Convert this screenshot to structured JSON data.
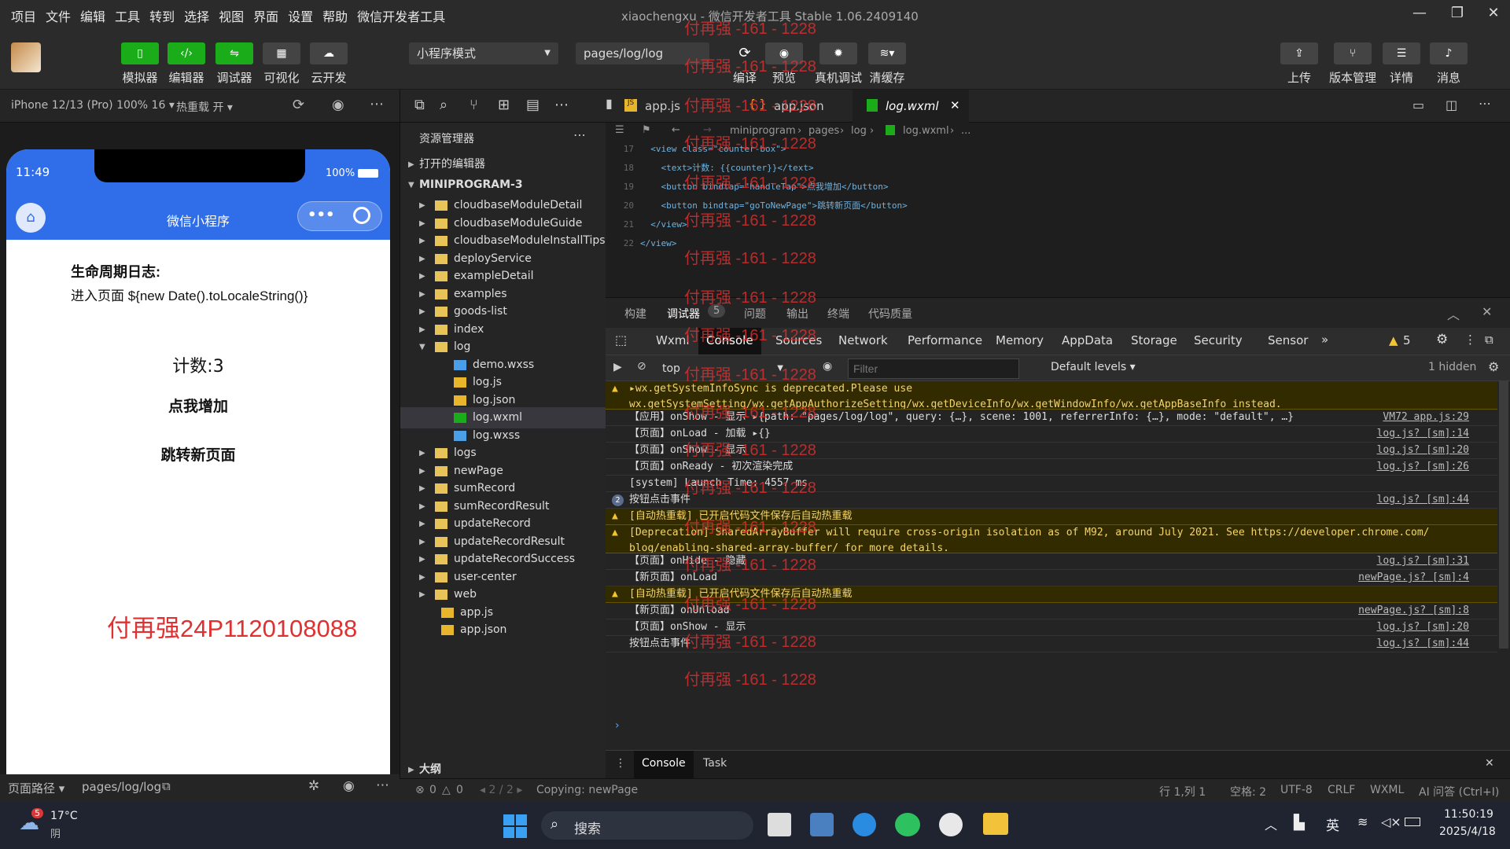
{
  "menu": [
    "项目",
    "文件",
    "编辑",
    "工具",
    "转到",
    "选择",
    "视图",
    "界面",
    "设置",
    "帮助",
    "微信开发者工具"
  ],
  "window_title": "xiaochengxu - 微信开发者工具 Stable 1.06.2409140",
  "toolbar": {
    "simulator": "模拟器",
    "editor": "编辑器",
    "debugger": "调试器",
    "visual": "可视化",
    "cloud": "云开发",
    "mode": "小程序模式",
    "path": "pages/log/log",
    "compile": "编译",
    "preview": "预览",
    "device_debug": "真机调试",
    "clear_cache": "清缓存",
    "upload": "上传",
    "version": "版本管理",
    "details": "详情",
    "messages": "消息"
  },
  "device": {
    "model": "iPhone 12/13 (Pro) 100% 16",
    "hot_reload": "热重载 开"
  },
  "phone": {
    "time": "11:49",
    "battery": "100%",
    "title": "微信小程序",
    "heading": "生命周期日志:",
    "log_line": "进入页面 ${new Date().toLocaleString()}",
    "counter": "计数:3",
    "btn_add": "点我增加",
    "btn_nav": "跳转新页面",
    "watermark": "付再强24P1120108088"
  },
  "sim_footer": {
    "path_label": "页面路径",
    "path": "pages/log/log"
  },
  "explorer": {
    "title": "资源管理器",
    "open_editors": "打开的编辑器",
    "project": "MINIPROGRAM-3",
    "outline": "大纲",
    "items": [
      {
        "n": "cloudbaseModuleDetail",
        "t": "dir",
        "d": 1
      },
      {
        "n": "cloudbaseModuleGuide",
        "t": "dir",
        "d": 1
      },
      {
        "n": "cloudbaseModuleInstallTips",
        "t": "dir",
        "d": 1
      },
      {
        "n": "deployService",
        "t": "dir",
        "d": 1
      },
      {
        "n": "exampleDetail",
        "t": "dir",
        "d": 1
      },
      {
        "n": "examples",
        "t": "dir",
        "d": 1
      },
      {
        "n": "goods-list",
        "t": "dir",
        "d": 1
      },
      {
        "n": "index",
        "t": "dir",
        "d": 1
      },
      {
        "n": "log",
        "t": "open",
        "d": 1
      },
      {
        "n": "demo.wxss",
        "t": "wxss",
        "d": 2
      },
      {
        "n": "log.js",
        "t": "js",
        "d": 2
      },
      {
        "n": "log.json",
        "t": "json",
        "d": 2
      },
      {
        "n": "log.wxml",
        "t": "wxml",
        "d": 2
      },
      {
        "n": "log.wxss",
        "t": "wxss",
        "d": 2
      },
      {
        "n": "logs",
        "t": "dir",
        "d": 1
      },
      {
        "n": "newPage",
        "t": "dir",
        "d": 1
      },
      {
        "n": "sumRecord",
        "t": "dir",
        "d": 1
      },
      {
        "n": "sumRecordResult",
        "t": "dir",
        "d": 1
      },
      {
        "n": "updateRecord",
        "t": "dir",
        "d": 1
      },
      {
        "n": "updateRecordResult",
        "t": "dir",
        "d": 1
      },
      {
        "n": "updateRecordSuccess",
        "t": "dir",
        "d": 1
      },
      {
        "n": "user-center",
        "t": "dir",
        "d": 1
      },
      {
        "n": "web",
        "t": "dir",
        "d": 1
      },
      {
        "n": "app.js",
        "t": "js",
        "d": 0
      },
      {
        "n": "app.json",
        "t": "json",
        "d": 0
      }
    ]
  },
  "tabs": [
    "app.js",
    "app.json",
    "log.wxml"
  ],
  "breadcrumb": [
    "miniprogram",
    "pages",
    "log",
    "log.wxml",
    "..."
  ],
  "code": [
    {
      "n": "17",
      "t": "  <view class=\"counter-box\">"
    },
    {
      "n": "18",
      "t": "    <text>计数: {{counter}}</text>"
    },
    {
      "n": "19",
      "t": "    <button bindtap=\"handleTap\">点我增加</button>"
    },
    {
      "n": "20",
      "t": "    <button bindtap=\"goToNewPage\">跳转新页面</button>"
    },
    {
      "n": "21",
      "t": "  </view>"
    },
    {
      "n": "22",
      "t": "</view>"
    }
  ],
  "panel_tabs": [
    "构建",
    "调试器",
    "5",
    "问题",
    "输出",
    "终端",
    "代码质量"
  ],
  "devtools_tabs": [
    "Wxml",
    "Console",
    "Sources",
    "Network",
    "Performance",
    "Memory",
    "AppData",
    "Storage",
    "Security",
    "Sensor"
  ],
  "warn_count": "5",
  "console": {
    "context": "top",
    "filter_placeholder": "Filter",
    "levels": "Default levels",
    "hidden": "1 hidden",
    "rows": [
      {
        "w": 1,
        "h": 36,
        "t": "▸wx.getSystemInfoSync is deprecated.Please use\nwx.getSystemSetting/wx.getAppAuthorizeSetting/wx.getDeviceInfo/wx.getWindowInfo/wx.getAppBaseInfo instead.",
        "s": ""
      },
      {
        "w": 0,
        "h": 21,
        "t": "【应用】onShow - 显示 ▸{path: \"pages/log/log\", query: {…}, scene: 1001, referrerInfo: {…}, mode: \"default\", …}",
        "s": "VM72 app.js:29"
      },
      {
        "w": 0,
        "h": 21,
        "t": "【页面】onLoad - 加载 ▸{}",
        "s": "log.js? [sm]:14"
      },
      {
        "w": 0,
        "h": 21,
        "t": "【页面】onShow - 显示",
        "s": "log.js? [sm]:20"
      },
      {
        "w": 0,
        "h": 21,
        "t": "【页面】onReady - 初次渲染完成",
        "s": "log.js? [sm]:26"
      },
      {
        "w": 0,
        "h": 21,
        "t": "[system] Launch Time: 4557 ms",
        "s": ""
      },
      {
        "w": 0,
        "h": 21,
        "t": "按钮点击事件",
        "s": "log.js? [sm]:44",
        "badge": "2"
      },
      {
        "w": 1,
        "h": 21,
        "t": "[自动热重载] 已开启代码文件保存后自动热重载",
        "s": ""
      },
      {
        "w": 1,
        "h": 36,
        "t": "[Deprecation] SharedArrayBuffer will require cross-origin isolation as of M92, around July 2021. See https://developer.chrome.com/\nblog/enabling-shared-array-buffer/ for more details.",
        "s": ""
      },
      {
        "w": 0,
        "h": 21,
        "t": "【页面】onHide - 隐藏",
        "s": "log.js? [sm]:31"
      },
      {
        "w": 0,
        "h": 21,
        "t": "【新页面】onLoad",
        "s": "newPage.js? [sm]:4"
      },
      {
        "w": 1,
        "h": 21,
        "t": "[自动热重载] 已开启代码文件保存后自动热重载",
        "s": ""
      },
      {
        "w": 0,
        "h": 21,
        "t": "【新页面】onUnload",
        "s": "newPage.js? [sm]:8"
      },
      {
        "w": 0,
        "h": 21,
        "t": "【页面】onShow - 显示",
        "s": "log.js? [sm]:20"
      },
      {
        "w": 0,
        "h": 21,
        "t": "按钮点击事件",
        "s": "log.js? [sm]:44"
      }
    ]
  },
  "drawer": {
    "console": "Console",
    "task": "Task"
  },
  "status": {
    "errors": "0",
    "warnings": "0",
    "pos": "2 / 2",
    "msg": "Copying: newPage",
    "line": "行 1,列 1",
    "spaces": "空格: 2",
    "enc": "UTF-8",
    "eol": "CRLF",
    "lang": "WXML",
    "ai": "AI 问答 (Ctrl+I)"
  },
  "taskbar": {
    "temp": "17°C",
    "weather": "阴",
    "badge": "5",
    "search": "搜索",
    "ime": "英",
    "time": "11:50:19",
    "date": "2025/4/18"
  },
  "overlay_watermark": "付再强 -161 - 1228"
}
